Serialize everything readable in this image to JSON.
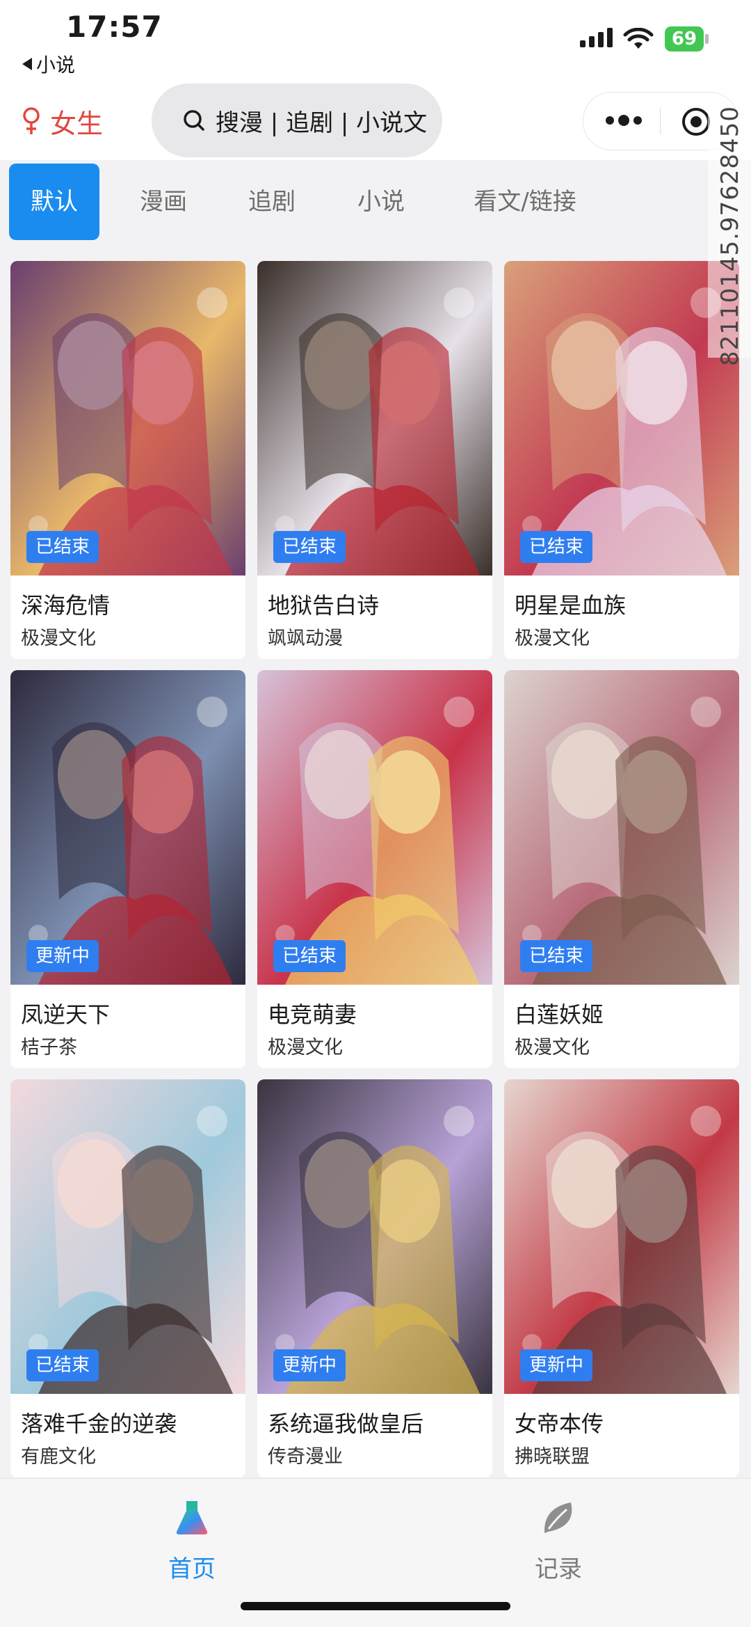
{
  "status_bar": {
    "time": "17:57",
    "back_label": "小说",
    "battery": "69"
  },
  "header": {
    "gender_label": "女生",
    "search_text": "搜漫 | 追剧 | 小说文",
    "icons": [
      "female-icon",
      "search-icon",
      "more-dots-icon",
      "target-icon"
    ]
  },
  "tabs": [
    {
      "label": "默认",
      "active": true
    },
    {
      "label": "漫画",
      "active": false
    },
    {
      "label": "追剧",
      "active": false
    },
    {
      "label": "小说",
      "active": false
    },
    {
      "label": "看文/链接",
      "active": false
    }
  ],
  "watermark": "82110145.97628450",
  "comics": [
    {
      "title": "深海危情",
      "author": "极漫文化",
      "status": "已结束",
      "colors": [
        "#6a3f6e",
        "#c2344a",
        "#e8b86a"
      ]
    },
    {
      "title": "地狱告白诗",
      "author": "飒飒动漫",
      "status": "已结束",
      "colors": [
        "#3a2f2a",
        "#b8202c",
        "#e6e0e8"
      ]
    },
    {
      "title": "明星是血族",
      "author": "极漫文化",
      "status": "已结束",
      "colors": [
        "#d9a07a",
        "#e9d7ee",
        "#c23a52"
      ]
    },
    {
      "title": "凤逆天下",
      "author": "桔子茶",
      "status": "更新中",
      "colors": [
        "#2e2a3e",
        "#b32230",
        "#7d8fb0"
      ]
    },
    {
      "title": "电竞萌妻",
      "author": "极漫文化",
      "status": "已结束",
      "colors": [
        "#d6c2d8",
        "#f2cf6a",
        "#c8334a"
      ]
    },
    {
      "title": "白莲妖姬",
      "author": "极漫文化",
      "status": "已结束",
      "colors": [
        "#dcd3cf",
        "#7a5a4c",
        "#b86a78"
      ]
    },
    {
      "title": "落难千金的逆袭",
      "author": "有鹿文化",
      "status": "已结束",
      "colors": [
        "#f3d9dd",
        "#3a2a2a",
        "#9fc9dc"
      ]
    },
    {
      "title": "系统逼我做皇后",
      "author": "传奇漫业",
      "status": "更新中",
      "colors": [
        "#3a3440",
        "#d9b84a",
        "#b7a2d6"
      ]
    },
    {
      "title": "女帝本传",
      "author": "拂晓联盟",
      "status": "更新中",
      "colors": [
        "#e6d6cf",
        "#5a3a3a",
        "#c23a46"
      ]
    }
  ],
  "bottom_nav": [
    {
      "label": "首页",
      "icon": "flask-icon",
      "active": true,
      "color": "#1a8cf0"
    },
    {
      "label": "记录",
      "icon": "leaf-icon",
      "active": false,
      "color": "#8a8a8a"
    }
  ]
}
